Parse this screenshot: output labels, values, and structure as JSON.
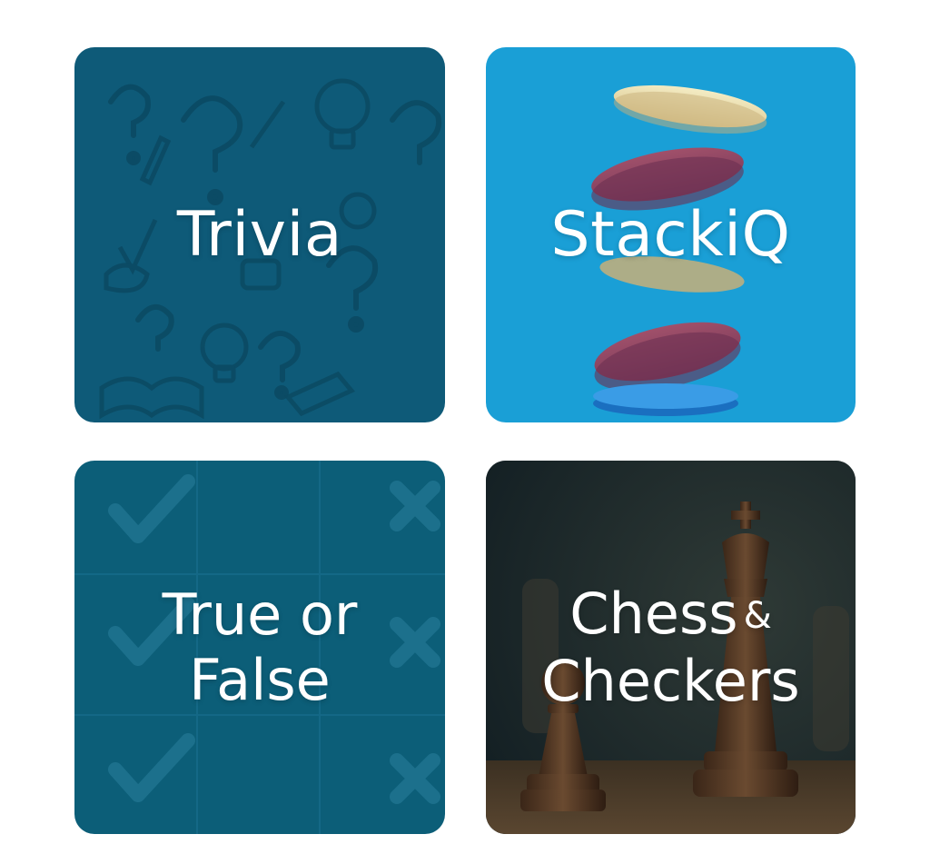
{
  "tiles": {
    "trivia": {
      "label": "Trivia",
      "color": "#0e5a78"
    },
    "stackiq": {
      "label": "StackiQ",
      "color": "#1a9fd6"
    },
    "true_or_false": {
      "line1": "True or",
      "line2": "False",
      "color": "#0c5e78"
    },
    "chess": {
      "line1": "Chess",
      "amp": "&",
      "line2": "Checkers",
      "color": "#1a2a2e"
    }
  },
  "icons": [
    "question-mark-doodle",
    "lightbulb-doodle",
    "pencil-doodle",
    "book-doodle",
    "checkmark-icon",
    "x-mark-icon",
    "game-chip",
    "chess-king",
    "chess-pawn"
  ]
}
